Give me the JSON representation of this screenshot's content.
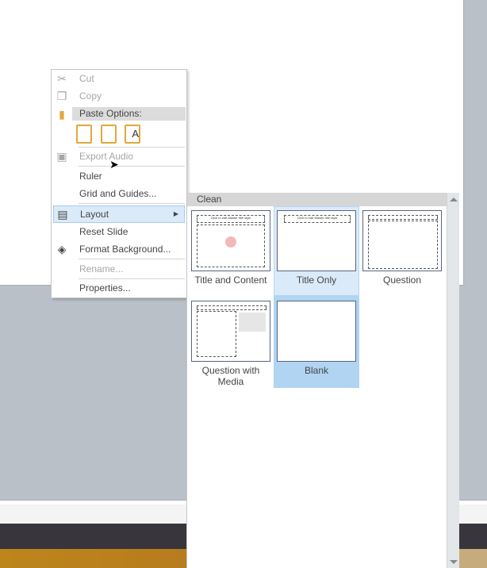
{
  "menu": {
    "cut": "Cut",
    "copy": "Copy",
    "paste_options": "Paste Options:",
    "export_audio": "Export Audio",
    "ruler": "Ruler",
    "grid": "Grid and Guides...",
    "layout": "Layout",
    "reset": "Reset Slide",
    "format_bg": "Format Background...",
    "rename": "Rename...",
    "properties": "Properties..."
  },
  "gallery": {
    "section": "Clean",
    "layouts": [
      {
        "label": "Title and Content",
        "title_text": "Click to edit Master title style"
      },
      {
        "label": "Title Only",
        "title_text": "Click to edit Master title style"
      },
      {
        "label": "Question"
      },
      {
        "label": "Question with Media"
      },
      {
        "label": "Blank"
      }
    ]
  },
  "colors": {
    "hover": "#dbeaf8",
    "selected": "#b0d4f1",
    "accent_paste": "#e0a83c"
  }
}
